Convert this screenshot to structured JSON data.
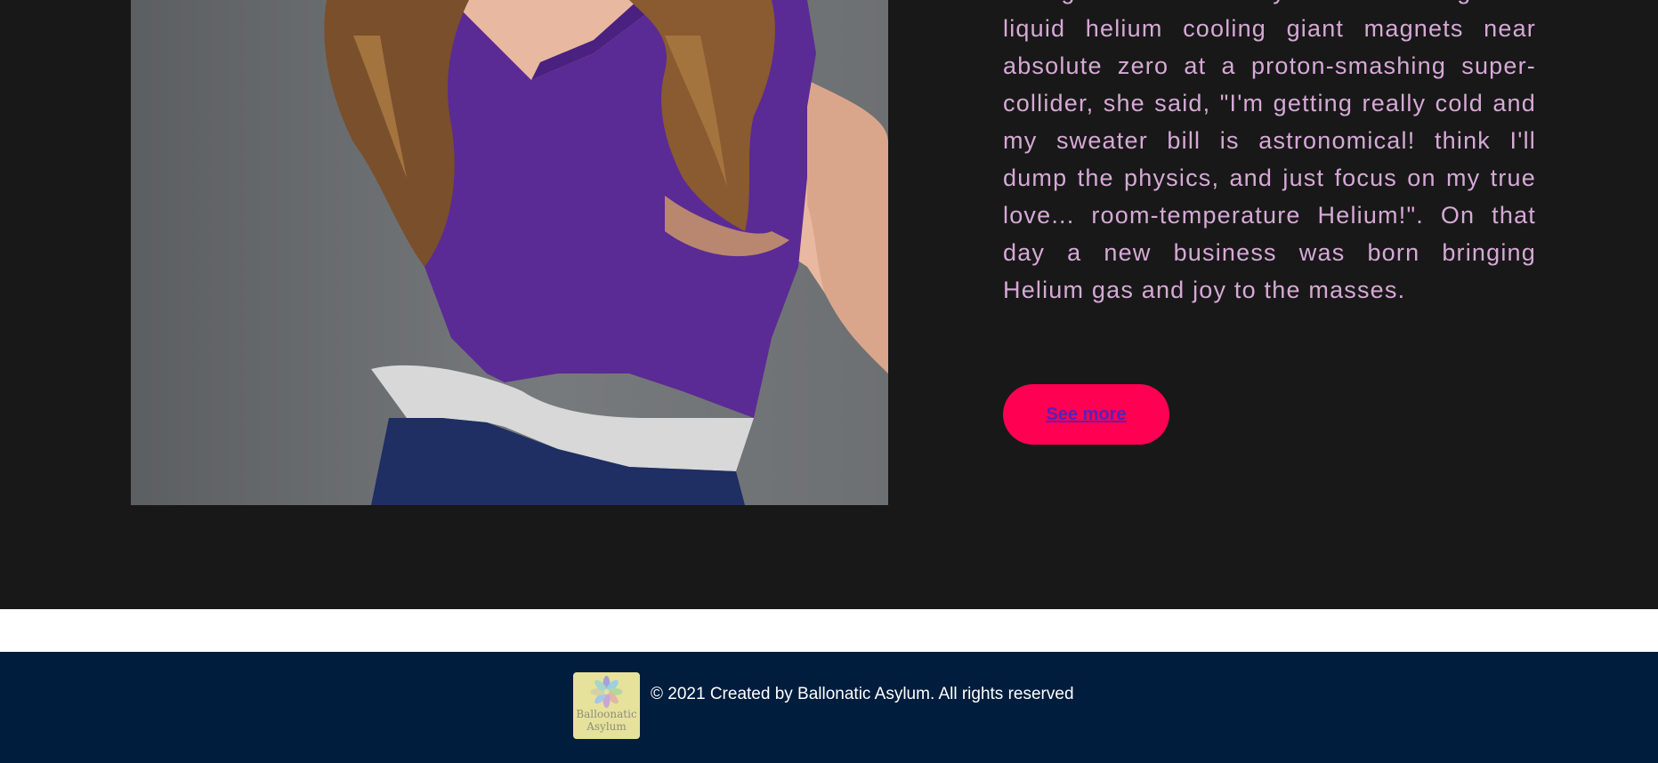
{
  "about": {
    "story": "two goldfish. One day while working with liquid helium cooling giant magnets near absolute zero at a proton-smashing super-collider, she said, \"I'm getting really cold and my sweater bill is astronomical! think I'll dump the physics, and just focus on my true love... room-temperature Helium!\". On that day a new business was born bringing Helium gas and joy to the masses.",
    "see_more_label": "See more"
  },
  "footer": {
    "logo_text_line1": "Balloonatic",
    "logo_text_line2": "Asylum",
    "copyright": "© 2021 Created by Ballonatic Asylum. All rights reserved"
  },
  "colors": {
    "background_dark": "#181818",
    "story_text": "#d6a9d6",
    "button_bg": "#ff0052",
    "button_text": "#5a1fb6",
    "footer_bg": "#001d3d",
    "logo_bg": "#e6e29b"
  }
}
